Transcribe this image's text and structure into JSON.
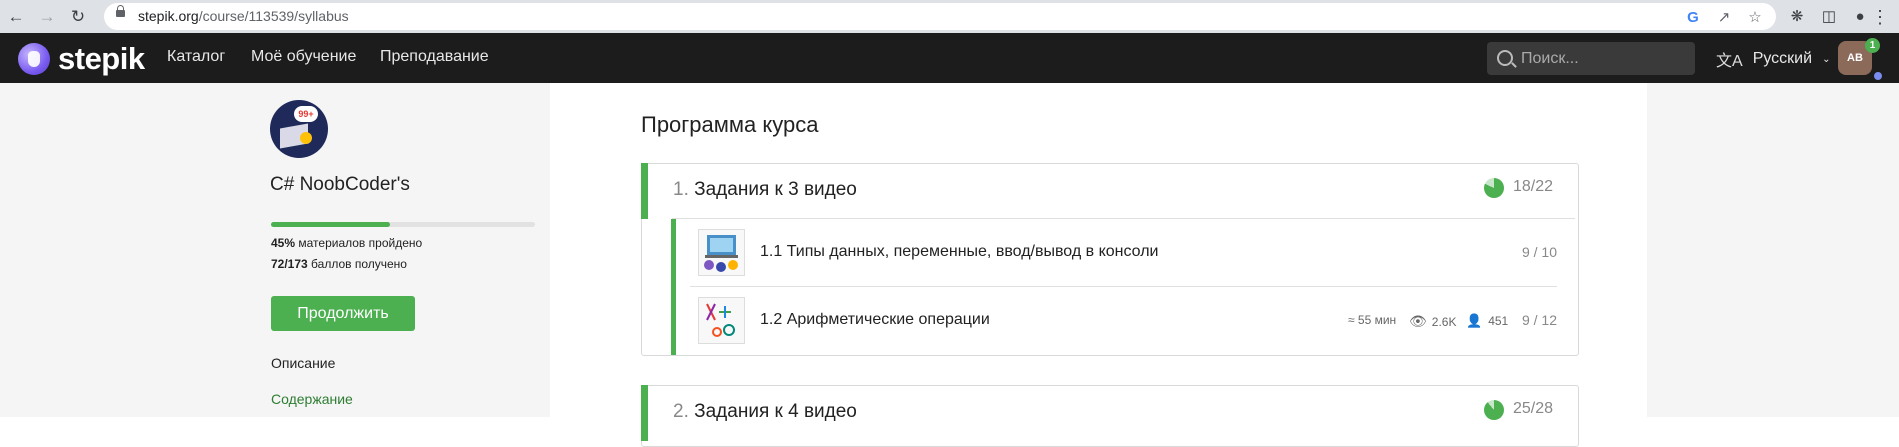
{
  "browser": {
    "url_host": "stepik.org",
    "url_path": "/course/113539/syllabus"
  },
  "header": {
    "logo_text": "stepik",
    "nav": [
      "Каталог",
      "Моё обучение",
      "Преподавание"
    ],
    "search_placeholder": "Поиск...",
    "language": "Русский",
    "avatar_initials": "AB",
    "notification_count": "1"
  },
  "sidebar": {
    "course_icon_badge": "99+",
    "course_title": "C# NoobCoder's",
    "progress_fraction": 0.45,
    "progress_percent": "45%",
    "progress_text": "материалов пройдено",
    "points": "72/173",
    "points_text": "баллов получено",
    "continue_label": "Продолжить",
    "links": [
      "Описание",
      "Содержание"
    ],
    "active_link_index": 1
  },
  "main": {
    "title": "Программа курса",
    "modules": [
      {
        "number": "1.",
        "name": "Задания к 3 видео",
        "score": "18/22",
        "progress_fraction": 0.82,
        "lessons": [
          {
            "title": "1.1 Типы данных, переменные, ввод/вывод в консоли",
            "score": "9 / 10"
          },
          {
            "title": "1.2 Арифметические операции",
            "duration": "≈ 55 мин",
            "views": "2.6K",
            "learners": "451",
            "score": "9 / 12"
          }
        ]
      },
      {
        "number": "2.",
        "name": "Задания к 4 видео",
        "score": "25/28",
        "progress_fraction": 0.89
      }
    ]
  },
  "colors": {
    "accent": "#4caf50",
    "topbar": "#1c1c1c"
  }
}
